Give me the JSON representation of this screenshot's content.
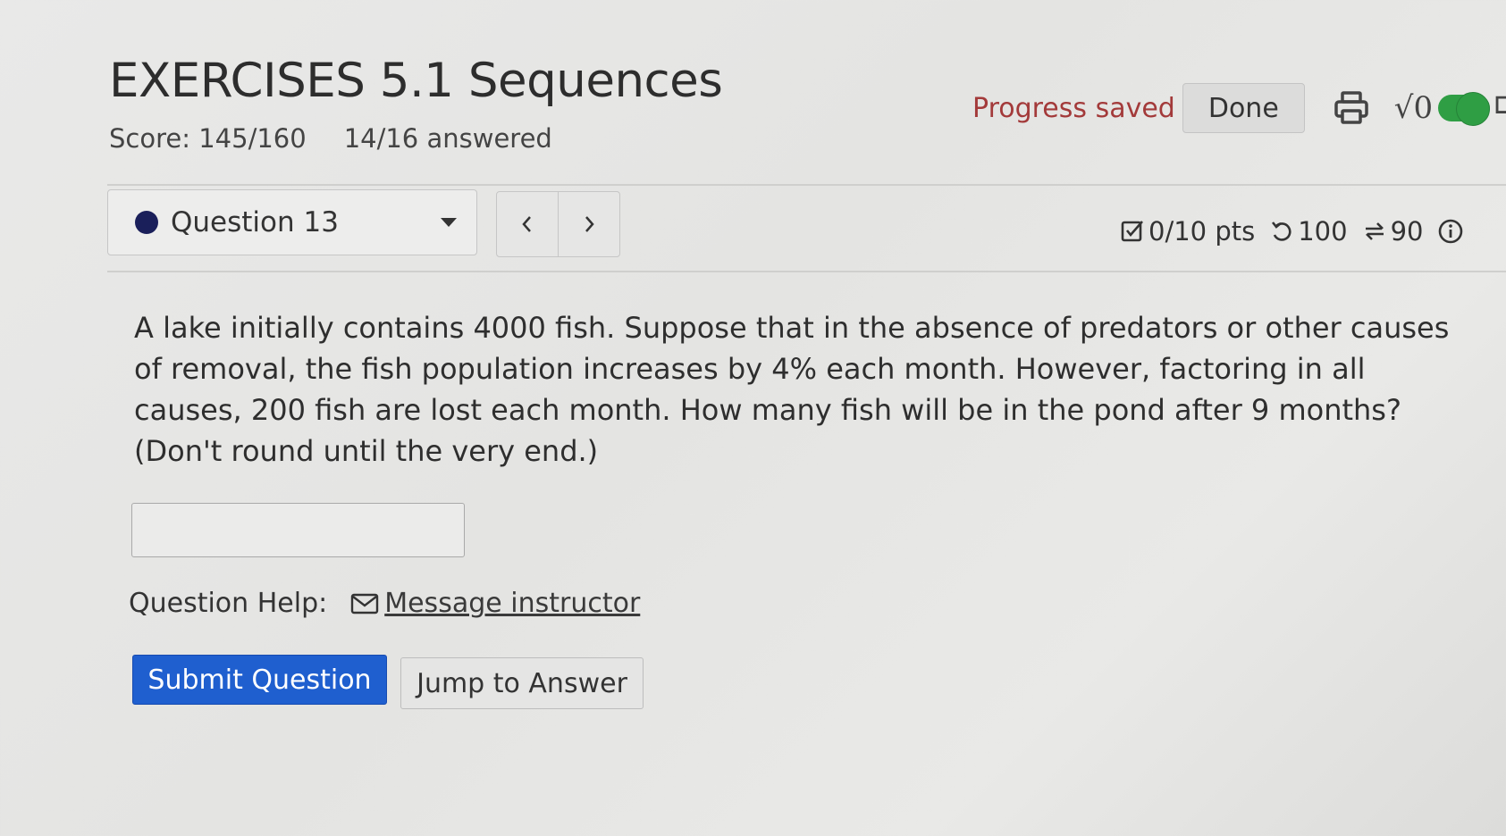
{
  "assignment": {
    "title": "EXERCISES 5.1 Sequences",
    "score": "Score: 145/160",
    "answered": "14/16 answered"
  },
  "header": {
    "progress_status": "Progress saved",
    "done_label": "Done",
    "sqrt_label": "√0",
    "math_toggle_on": true
  },
  "question_nav": {
    "selected": "Question 13",
    "prev_icon": "chevron-left-icon",
    "next_icon": "chevron-right-icon"
  },
  "stats": {
    "points": "0/10 pts",
    "retries": "100",
    "attempts": "90"
  },
  "question": {
    "text": "A lake initially contains 4000 fish. Suppose that in the absence of predators or other causes of removal, the fish population increases by 4% each month. However, factoring in all causes, 200 fish are lost each month.  How many fish will be in the pond after 9 months?  (Don't round until the very end.)",
    "answer_value": ""
  },
  "help": {
    "label": "Question Help:",
    "message_link": "Message instructor"
  },
  "actions": {
    "submit_label": "Submit Question",
    "jump_label": "Jump to Answer"
  },
  "colors": {
    "primary_button": "#1f5fcf",
    "progress_text": "#a33a3a",
    "toggle_on": "#2f9e44",
    "question_dot": "#1a1f5a"
  }
}
